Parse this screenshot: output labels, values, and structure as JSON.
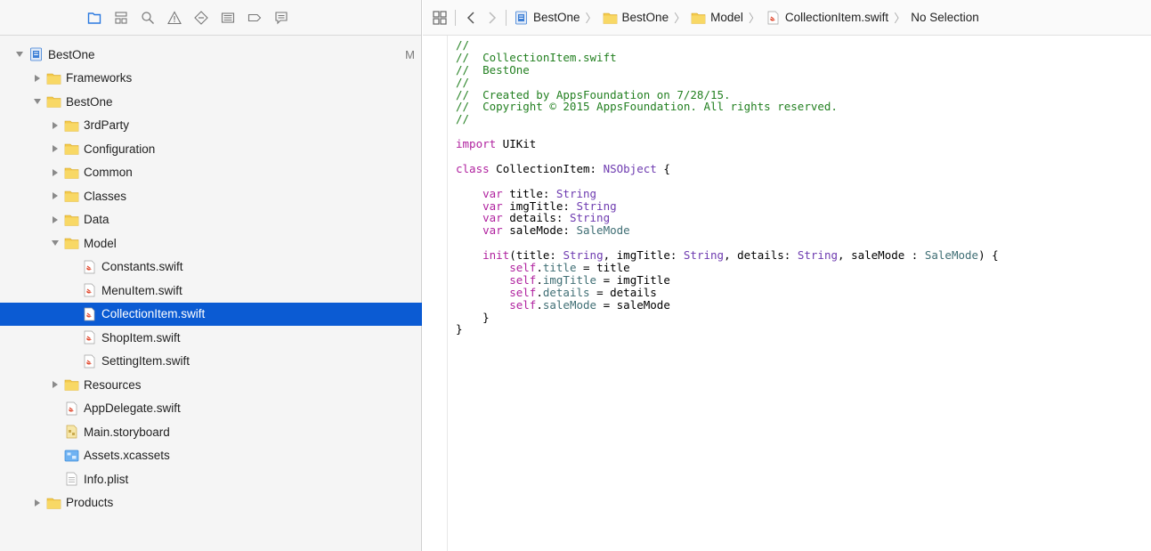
{
  "navigator": {
    "toolbar": [
      {
        "name": "project-navigator-icon",
        "active": true
      },
      {
        "name": "symbol-navigator-icon",
        "active": false
      },
      {
        "name": "find-navigator-icon",
        "active": false
      },
      {
        "name": "issue-navigator-icon",
        "active": false
      },
      {
        "name": "test-navigator-icon",
        "active": false
      },
      {
        "name": "debug-navigator-icon",
        "active": false
      },
      {
        "name": "breakpoint-navigator-icon",
        "active": false
      },
      {
        "name": "report-navigator-icon",
        "active": false
      }
    ],
    "tree": [
      {
        "label": "BestOne",
        "level": 0,
        "disclosure": "open",
        "icon": "project-icon",
        "badge": "M"
      },
      {
        "label": "Frameworks",
        "level": 1,
        "disclosure": "closed",
        "icon": "folder-icon"
      },
      {
        "label": "BestOne",
        "level": 1,
        "disclosure": "open",
        "icon": "folder-icon"
      },
      {
        "label": "3rdParty",
        "level": 2,
        "disclosure": "closed",
        "icon": "folder-icon"
      },
      {
        "label": "Configuration",
        "level": 2,
        "disclosure": "closed",
        "icon": "folder-icon"
      },
      {
        "label": "Common",
        "level": 2,
        "disclosure": "closed",
        "icon": "folder-icon"
      },
      {
        "label": "Classes",
        "level": 2,
        "disclosure": "closed",
        "icon": "folder-icon"
      },
      {
        "label": "Data",
        "level": 2,
        "disclosure": "closed",
        "icon": "folder-icon"
      },
      {
        "label": "Model",
        "level": 2,
        "disclosure": "open",
        "icon": "folder-icon"
      },
      {
        "label": "Constants.swift",
        "level": 3,
        "disclosure": "none",
        "icon": "swift-file-icon"
      },
      {
        "label": "MenuItem.swift",
        "level": 3,
        "disclosure": "none",
        "icon": "swift-file-icon"
      },
      {
        "label": "CollectionItem.swift",
        "level": 3,
        "disclosure": "none",
        "icon": "swift-file-icon",
        "selected": true
      },
      {
        "label": "ShopItem.swift",
        "level": 3,
        "disclosure": "none",
        "icon": "swift-file-icon"
      },
      {
        "label": "SettingItem.swift",
        "level": 3,
        "disclosure": "none",
        "icon": "swift-file-icon"
      },
      {
        "label": "Resources",
        "level": 2,
        "disclosure": "closed",
        "icon": "folder-icon"
      },
      {
        "label": "AppDelegate.swift",
        "level": 2,
        "disclosure": "none",
        "icon": "swift-file-icon"
      },
      {
        "label": "Main.storyboard",
        "level": 2,
        "disclosure": "none",
        "icon": "storyboard-icon"
      },
      {
        "label": "Assets.xcassets",
        "level": 2,
        "disclosure": "none",
        "icon": "assets-icon"
      },
      {
        "label": "Info.plist",
        "level": 2,
        "disclosure": "none",
        "icon": "plist-icon"
      },
      {
        "label": "Products",
        "level": 1,
        "disclosure": "closed",
        "icon": "folder-icon"
      }
    ]
  },
  "jumpbar": {
    "crumbs": [
      {
        "label": "BestOne",
        "icon": "project-icon"
      },
      {
        "label": "BestOne",
        "icon": "folder-icon"
      },
      {
        "label": "Model",
        "icon": "folder-icon"
      },
      {
        "label": "CollectionItem.swift",
        "icon": "swift-file-icon"
      },
      {
        "label": "No Selection",
        "icon": ""
      }
    ]
  },
  "code": [
    [
      [
        "c-comment",
        "//"
      ]
    ],
    [
      [
        "c-comment",
        "//  CollectionItem.swift"
      ]
    ],
    [
      [
        "c-comment",
        "//  BestOne"
      ]
    ],
    [
      [
        "c-comment",
        "//"
      ]
    ],
    [
      [
        "c-comment",
        "//  Created by AppsFoundation on 7/28/15."
      ]
    ],
    [
      [
        "c-comment",
        "//  Copyright © 2015 AppsFoundation. All rights reserved."
      ]
    ],
    [
      [
        "c-comment",
        "//"
      ]
    ],
    [],
    [
      [
        "c-kw",
        "import"
      ],
      [
        "c-plain",
        " UIKit"
      ]
    ],
    [],
    [
      [
        "c-kw",
        "class"
      ],
      [
        "c-plain",
        " CollectionItem: "
      ],
      [
        "c-type",
        "NSObject"
      ],
      [
        "c-plain",
        " {"
      ]
    ],
    [],
    [
      [
        "c-plain",
        "    "
      ],
      [
        "c-kw",
        "var"
      ],
      [
        "c-plain",
        " title: "
      ],
      [
        "c-type",
        "String"
      ]
    ],
    [
      [
        "c-plain",
        "    "
      ],
      [
        "c-kw",
        "var"
      ],
      [
        "c-plain",
        " imgTitle: "
      ],
      [
        "c-type",
        "String"
      ]
    ],
    [
      [
        "c-plain",
        "    "
      ],
      [
        "c-kw",
        "var"
      ],
      [
        "c-plain",
        " details: "
      ],
      [
        "c-type",
        "String"
      ]
    ],
    [
      [
        "c-plain",
        "    "
      ],
      [
        "c-kw",
        "var"
      ],
      [
        "c-plain",
        " saleMode: "
      ],
      [
        "c-prop",
        "SaleMode"
      ]
    ],
    [],
    [
      [
        "c-plain",
        "    "
      ],
      [
        "c-kw",
        "init"
      ],
      [
        "c-plain",
        "(title: "
      ],
      [
        "c-type",
        "String"
      ],
      [
        "c-plain",
        ", imgTitle: "
      ],
      [
        "c-type",
        "String"
      ],
      [
        "c-plain",
        ", details: "
      ],
      [
        "c-type",
        "String"
      ],
      [
        "c-plain",
        ", saleMode : "
      ],
      [
        "c-prop",
        "SaleMode"
      ],
      [
        "c-plain",
        ") {"
      ]
    ],
    [
      [
        "c-plain",
        "        "
      ],
      [
        "c-kw",
        "self"
      ],
      [
        "c-plain",
        "."
      ],
      [
        "c-prop",
        "title"
      ],
      [
        "c-plain",
        " = title"
      ]
    ],
    [
      [
        "c-plain",
        "        "
      ],
      [
        "c-kw",
        "self"
      ],
      [
        "c-plain",
        "."
      ],
      [
        "c-prop",
        "imgTitle"
      ],
      [
        "c-plain",
        " = imgTitle"
      ]
    ],
    [
      [
        "c-plain",
        "        "
      ],
      [
        "c-kw",
        "self"
      ],
      [
        "c-plain",
        "."
      ],
      [
        "c-prop",
        "details"
      ],
      [
        "c-plain",
        " = details"
      ]
    ],
    [
      [
        "c-plain",
        "        "
      ],
      [
        "c-kw",
        "self"
      ],
      [
        "c-plain",
        "."
      ],
      [
        "c-prop",
        "saleMode"
      ],
      [
        "c-plain",
        " = saleMode"
      ]
    ],
    [
      [
        "c-plain",
        "    }"
      ]
    ],
    [
      [
        "c-plain",
        "}"
      ]
    ]
  ]
}
